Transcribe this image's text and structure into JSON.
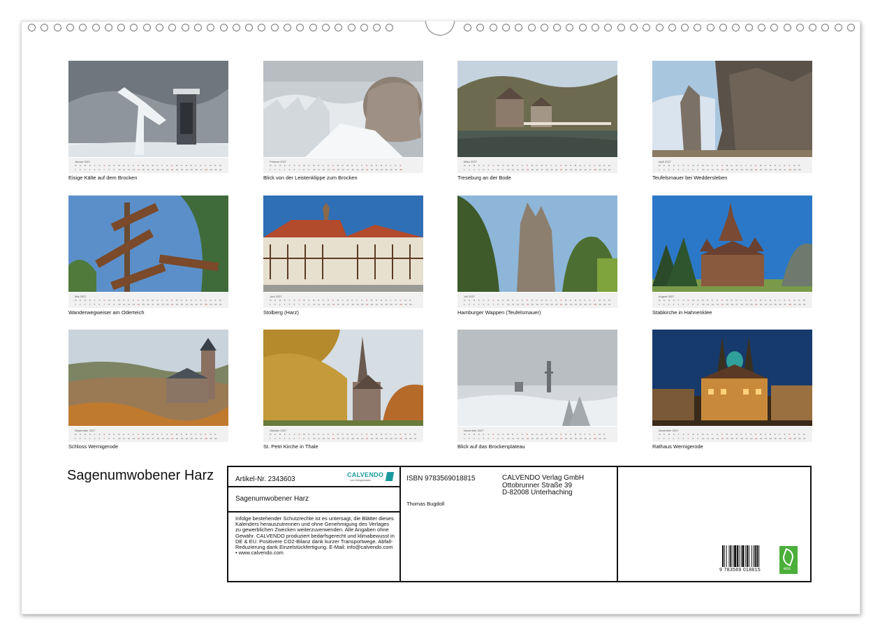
{
  "calendar": {
    "title": "Sagenumwobener Harz",
    "months": [
      {
        "month_label": "Januar 2027",
        "caption": "Eisige Kälte auf dem Brocken",
        "scene": "frost-tower"
      },
      {
        "month_label": "Februar 2027",
        "caption": "Blick von der Leistenklippe zum Brocken",
        "scene": "snow-rock"
      },
      {
        "month_label": "März 2027",
        "caption": "Treseburg an der Bode",
        "scene": "river-village"
      },
      {
        "month_label": "April 2027",
        "caption": "Teufelsmauer bei Weddersleben",
        "scene": "rock-wall"
      },
      {
        "month_label": "Mai 2027",
        "caption": "Wanderwegweiser am Oderteich",
        "scene": "signpost"
      },
      {
        "month_label": "Juni 2027",
        "caption": "Stolberg (Harz)",
        "scene": "timber-houses"
      },
      {
        "month_label": "Juli 2027",
        "caption": "Hamburger Wappen (Teufelsmauer)",
        "scene": "rock-forest"
      },
      {
        "month_label": "August 2027",
        "caption": "Stabkirche in Hahnenklee",
        "scene": "stave-church"
      },
      {
        "month_label": "September 2027",
        "caption": "Schloss Wernigerode",
        "scene": "castle"
      },
      {
        "month_label": "Oktober 2027",
        "caption": "St. Petri Kirche in Thale",
        "scene": "autumn-church"
      },
      {
        "month_label": "November 2027",
        "caption": "Blick auf das Brockenplateau",
        "scene": "fog-plateau"
      },
      {
        "month_label": "Dezember 2027",
        "caption": "Rathaus Wernigerode",
        "scene": "night-townhall"
      }
    ]
  },
  "info": {
    "article_number": "Artikel-Nr. 2343603",
    "logo_text": "CALVENDO",
    "logo_sub": "zum Wertgedanken",
    "subtitle": "Sagenumwobener Harz",
    "disclaimer": "Infolge bestehender Schutzrechte ist es untersagt, die Blätter dieses Kalenders herauszutrennen und ohne Genehmigung des Verlages zu gewerblichen Zwecken weiterzuverwenden. Alle Angaben ohne Gewähr. CALVENDO produziert bedarfsgerecht und klimabewusst in DE & EU. Positivere CO2-Bilanz dank kurzer Transportwege. Abfall-Reduzierung dank Einzelstückfertigung. E-Mail: info@calvendo.com • www.calvendo.com",
    "isbn": "ISBN 9783569018815",
    "author": "Thomas Bugdoll",
    "publisher_lines": [
      "CALVENDO Verlag GmbH",
      "Ottobrunner Straße 39",
      "D-82008 Unterhaching"
    ],
    "barcode_digits": "9 783569 018815",
    "eco_label": "eco"
  },
  "colors": {
    "brand": "#1a9aa0",
    "eco": "#4caf3a"
  }
}
